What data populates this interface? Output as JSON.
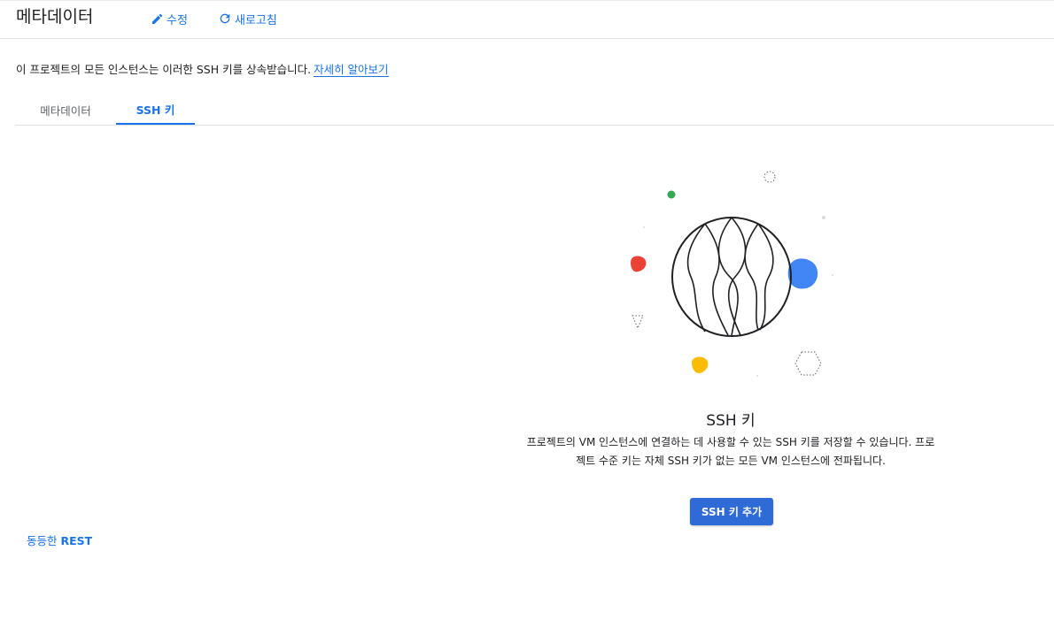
{
  "header": {
    "title": "메타데이터",
    "edit_label": "수정",
    "refresh_label": "새로고침"
  },
  "info": {
    "text": "이 프로젝트의 모든 인스턴스는 이러한 SSH 키를 상속받습니다.",
    "learn_more": "자세히 알아보기"
  },
  "tabs": [
    {
      "label": "메타데이터",
      "active": false
    },
    {
      "label": "SSH 키",
      "active": true
    }
  ],
  "empty_state": {
    "title": "SSH 키",
    "description": "프로젝트의 VM 인스턴스에 연결하는 데 사용할 수 있는 SSH 키를 저장할 수 있습니다. 프로젝트 수준 키는 자체 SSH 키가 없는 모든 VM 인스턴스에 전파됩니다.",
    "add_button": "SSH 키 추가"
  },
  "footer": {
    "rest_prefix": "동등한",
    "rest_suffix": "REST"
  },
  "colors": {
    "accent": "#1a73e8",
    "button": "#2f6bd6",
    "green": "#34a853",
    "red": "#ea4335",
    "blue": "#4285f4",
    "yellow": "#fbbc04"
  },
  "icons": {
    "edit": "pencil-icon",
    "refresh": "refresh-icon"
  }
}
